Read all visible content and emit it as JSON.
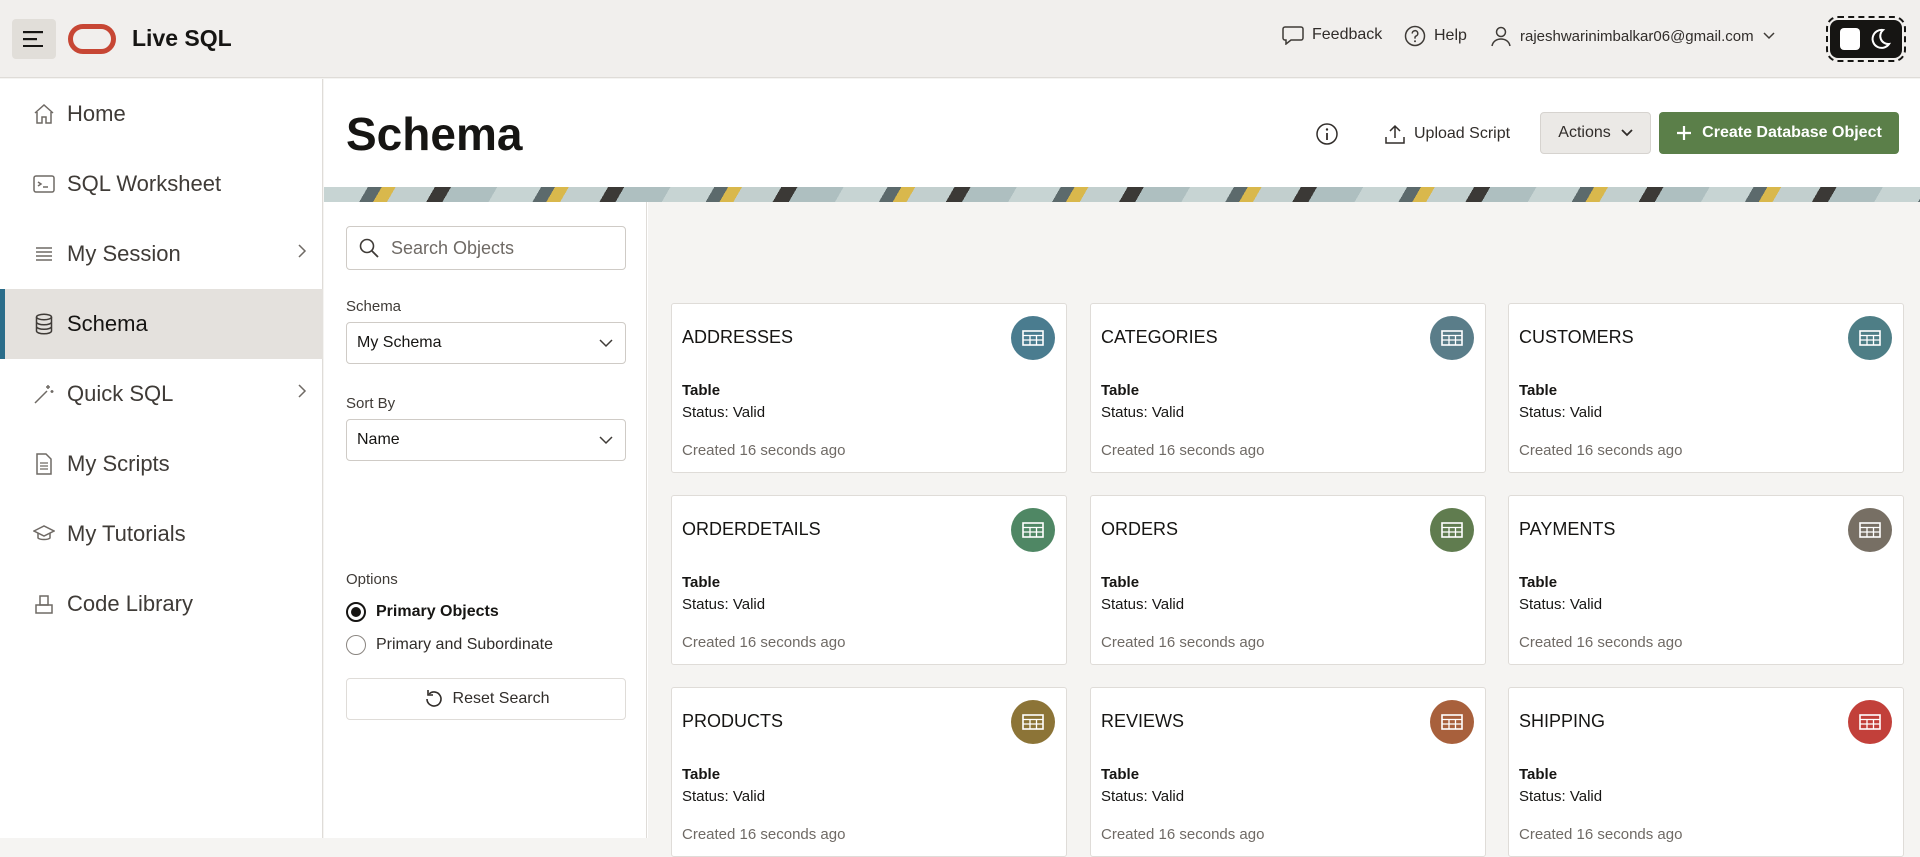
{
  "topbar": {
    "app_title": "Live SQL",
    "feedback_label": "Feedback",
    "help_label": "Help",
    "user_email": "rajeshwarinimbalkar06@gmail.com"
  },
  "sidebar": {
    "items": [
      {
        "label": "Home",
        "icon": "home-icon"
      },
      {
        "label": "SQL Worksheet",
        "icon": "worksheet-icon"
      },
      {
        "label": "My Session",
        "icon": "list-icon",
        "has_submenu": true
      },
      {
        "label": "Schema",
        "icon": "database-icon",
        "active": true
      },
      {
        "label": "Quick SQL",
        "icon": "wand-icon",
        "has_submenu": true
      },
      {
        "label": "My Scripts",
        "icon": "document-icon"
      },
      {
        "label": "My Tutorials",
        "icon": "graduation-cap-icon"
      },
      {
        "label": "Code Library",
        "icon": "library-icon"
      }
    ]
  },
  "header": {
    "page_title": "Schema",
    "upload_label": "Upload Script",
    "actions_label": "Actions",
    "create_label": "Create Database Object"
  },
  "filters": {
    "search_placeholder": "Search Objects",
    "schema_label": "Schema",
    "schema_value": "My Schema",
    "sort_label": "Sort By",
    "sort_value": "Name",
    "options_label": "Options",
    "option_primary": "Primary Objects",
    "option_both": "Primary and Subordinate",
    "selected_option": "Primary Objects",
    "reset_label": "Reset Search"
  },
  "objects": [
    {
      "name": "ADDRESSES",
      "type": "Table",
      "status": "Status: Valid",
      "created": "Created 16 seconds ago",
      "color": "#4a7c8f"
    },
    {
      "name": "CATEGORIES",
      "type": "Table",
      "status": "Status: Valid",
      "created": "Created 16 seconds ago",
      "color": "#5a7d89"
    },
    {
      "name": "CUSTOMERS",
      "type": "Table",
      "status": "Status: Valid",
      "created": "Created 16 seconds ago",
      "color": "#4e7e86"
    },
    {
      "name": "ORDERDETAILS",
      "type": "Table",
      "status": "Status: Valid",
      "created": "Created 16 seconds ago",
      "color": "#4f8764"
    },
    {
      "name": "ORDERS",
      "type": "Table",
      "status": "Status: Valid",
      "created": "Created 16 seconds ago",
      "color": "#607c4f"
    },
    {
      "name": "PAYMENTS",
      "type": "Table",
      "status": "Status: Valid",
      "created": "Created 16 seconds ago",
      "color": "#776f64"
    },
    {
      "name": "PRODUCTS",
      "type": "Table",
      "status": "Status: Valid",
      "created": "Created 16 seconds ago",
      "color": "#8c7437"
    },
    {
      "name": "REVIEWS",
      "type": "Table",
      "status": "Status: Valid",
      "created": "Created 16 seconds ago",
      "color": "#a8603c"
    },
    {
      "name": "SHIPPING",
      "type": "Table",
      "status": "Status: Valid",
      "created": "Created 16 seconds ago",
      "color": "#c2403a"
    }
  ]
}
